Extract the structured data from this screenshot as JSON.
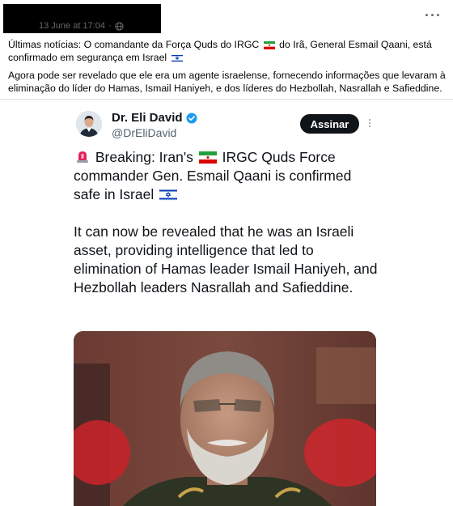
{
  "post": {
    "date": "13 June at 17:04",
    "dot": "·",
    "more": "···",
    "paragraph1_a": "Últimas notícias: O comandante da Força Quds do IRGC",
    "paragraph1_b": "do Irã, General Esmail Qaani, está confirmado em segurança em Israel",
    "paragraph2": "Agora pode ser revelado que ele era um agente israelense, fornecendo informações que levaram à eliminação do líder do Hamas, Ismail Haniyeh, e dos líderes do Hezbollah, Nasrallah e Safieddine."
  },
  "tweet": {
    "author_name": "Dr. Eli David",
    "handle": "@DrEliDavid",
    "follow_label": "Assinar",
    "line1_a": "Breaking: Iran's",
    "line1_b": "IRGC Quds Force commander Gen. Esmail Qaani is confirmed safe in Israel",
    "paragraph2": "It can now be revealed that he was an Israeli asset, providing intelligence that led to elimination of Hamas leader Ismail Haniyeh, and Hezbollah leaders Nasrallah and Safieddine."
  },
  "icons": {
    "globe": "globe-icon",
    "verified": "verified-badge-icon",
    "siren": "police-light-icon",
    "iran_flag": "iran-flag-icon",
    "israel_flag": "israel-flag-icon",
    "kebab": "more-vertical-icon"
  },
  "colors": {
    "follow_bg": "#0f1419",
    "verified": "#1d9bf0",
    "meta_text": "#65676b"
  }
}
